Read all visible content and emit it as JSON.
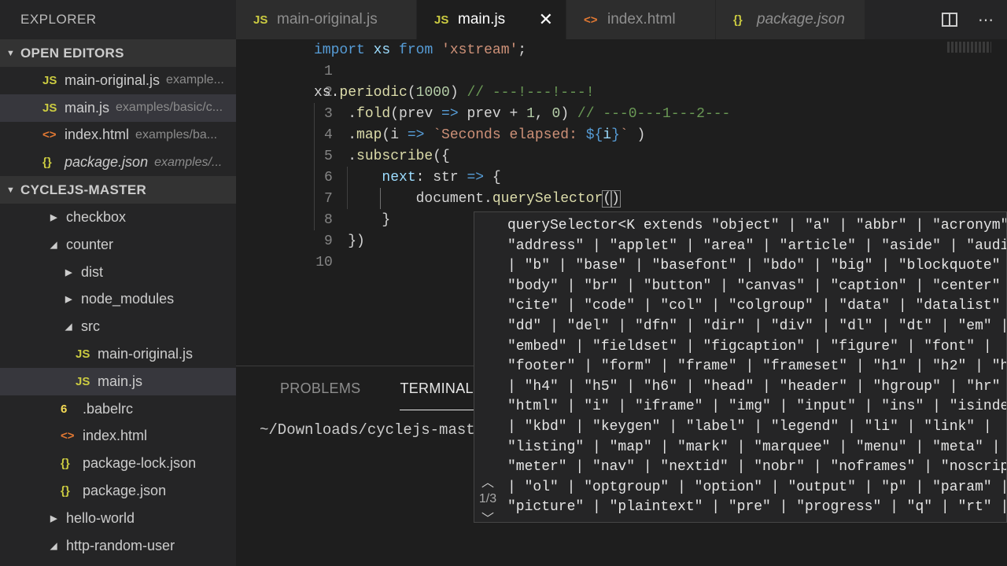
{
  "sidebar": {
    "title": "EXPLORER",
    "open_editors": {
      "label": "OPEN EDITORS",
      "items": [
        {
          "name": "main-original.js",
          "desc": "example...",
          "icon": "js-file-icon"
        },
        {
          "name": "main.js",
          "desc": "examples/basic/c...",
          "icon": "js-file-icon"
        },
        {
          "name": "index.html",
          "desc": "examples/ba...",
          "icon": "html-file-icon"
        },
        {
          "name": "package.json",
          "desc": "examples/...",
          "icon": "json-file-icon"
        }
      ]
    },
    "project": {
      "label": "CYCLEJS-MASTER",
      "items": [
        {
          "name": "checkbox"
        },
        {
          "name": "counter"
        },
        {
          "name": "dist"
        },
        {
          "name": "node_modules"
        },
        {
          "name": "src"
        },
        {
          "name": "main-original.js"
        },
        {
          "name": "main.js"
        },
        {
          "name": ".babelrc"
        },
        {
          "name": "index.html"
        },
        {
          "name": "package-lock.json"
        },
        {
          "name": "package.json"
        },
        {
          "name": "hello-world"
        },
        {
          "name": "http-random-user"
        }
      ]
    }
  },
  "tabs": [
    {
      "label": "main-original.js"
    },
    {
      "label": "main.js",
      "close": "✕"
    },
    {
      "label": "index.html"
    },
    {
      "label": "package.json"
    }
  ],
  "icons": {
    "js": "JS",
    "html": "<>",
    "json": "{}",
    "babel": "6"
  },
  "editor": {
    "line_numbers": [
      "1",
      "2",
      "3",
      "4",
      "5",
      "6",
      "7",
      "8",
      "9",
      "10"
    ]
  },
  "panel": {
    "tabs": [
      "PROBLEMS",
      "TERMINAL"
    ],
    "terminal_line": "~/Downloads/cyclejs-maste"
  },
  "hover": {
    "counter": "1/3",
    "signature": "querySelector<K extends \"object\" | \"a\" | \"abbr\" | \"acronym\" |\n\"address\" | \"applet\" | \"area\" | \"article\" | \"aside\" | \"audio\"\n| \"b\" | \"base\" | \"basefont\" | \"bdo\" | \"big\" | \"blockquote\" |\n\"body\" | \"br\" | \"button\" | \"canvas\" | \"caption\" | \"center\" |\n\"cite\" | \"code\" | \"col\" | \"colgroup\" | \"data\" | \"datalist\" |\n\"dd\" | \"del\" | \"dfn\" | \"dir\" | \"div\" | \"dl\" | \"dt\" | \"em\" |\n\"embed\" | \"fieldset\" | \"figcaption\" | \"figure\" | \"font\" |\n\"footer\" | \"form\" | \"frame\" | \"frameset\" | \"h1\" | \"h2\" | \"h3\"\n| \"h4\" | \"h5\" | \"h6\" | \"head\" | \"header\" | \"hgroup\" | \"hr\" |\n\"html\" | \"i\" | \"iframe\" | \"img\" | \"input\" | \"ins\" | \"isindex\"\n| \"kbd\" | \"keygen\" | \"label\" | \"legend\" | \"li\" | \"link\" |\n\"listing\" | \"map\" | \"mark\" | \"marquee\" | \"menu\" | \"meta\" |\n\"meter\" | \"nav\" | \"nextid\" | \"nobr\" | \"noframes\" | \"noscript\"\n| \"ol\" | \"optgroup\" | \"option\" | \"output\" | \"p\" | \"param\" |\n\"picture\" | \"plaintext\" | \"pre\" | \"progress\" | \"q\" | \"rt\" |"
  },
  "code": {
    "l1": {
      "kw1": "import",
      "sp1": " ",
      "id": "xs",
      "sp2": " ",
      "kw2": "from",
      "sp3": " ",
      "str": "'xstream'",
      "end": ";"
    },
    "l3": {
      "a": "xs.",
      "fn": "periodic",
      "b": "(",
      "num": "1000",
      "c": ") ",
      "cm": "// ---!---!---!"
    },
    "l4": {
      "a": "    .",
      "fn": "fold",
      "b": "(prev ",
      "ar": "=>",
      "c": " prev + ",
      "n1": "1",
      "d": ", ",
      "n2": "0",
      "e": ") ",
      "cm": "// ---0---1---2---"
    },
    "l5": {
      "a": "    .",
      "fn": "map",
      "b": "(i ",
      "ar": "=>",
      "c": " ",
      "s1": "`Seconds elapsed: ",
      "t1": "${",
      "v": "i",
      "t2": "}",
      "s2": "`",
      "d": " )"
    },
    "l6": {
      "a": "    .",
      "fn": "subscribe",
      "b": "({"
    },
    "l7": {
      "a": "        ",
      "key": "next",
      "b": ": str ",
      "ar": "=>",
      "c": " {"
    },
    "l8": {
      "a": "            document.",
      "fn": "querySelector",
      "b": "(",
      "c": ")"
    },
    "l9": {
      "a": "        }"
    },
    "l10": {
      "a": "    })"
    }
  }
}
